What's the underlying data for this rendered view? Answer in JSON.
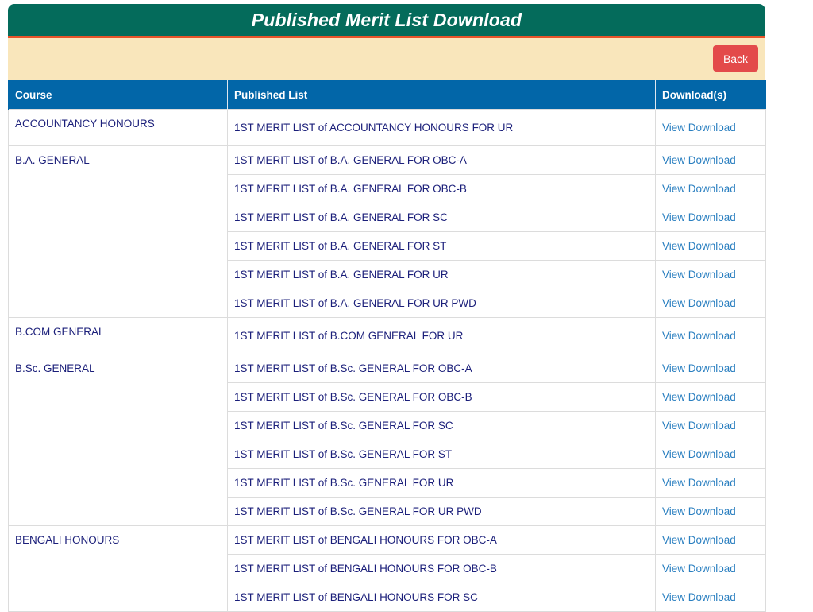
{
  "header": {
    "title": "Published Merit List Download",
    "back_label": "Back"
  },
  "colors": {
    "title_bg": "#046b5b",
    "title_border": "#e8542a",
    "action_bg": "#f9e6bb",
    "back_button": "#e34a4a",
    "table_header": "#0266a8",
    "text": "#1b1f7a",
    "link": "#2a7fc0"
  },
  "table": {
    "columns": [
      "Course",
      "Published List",
      "Download(s)"
    ],
    "download_label": "View Download",
    "groups": [
      {
        "course": "ACCOUNTANCY HONOURS",
        "lists": [
          "1ST MERIT LIST of ACCOUNTANCY HONOURS FOR UR"
        ]
      },
      {
        "course": "B.A. GENERAL",
        "lists": [
          "1ST MERIT LIST of B.A. GENERAL FOR OBC-A",
          "1ST MERIT LIST of B.A. GENERAL FOR OBC-B",
          "1ST MERIT LIST of B.A. GENERAL FOR SC",
          "1ST MERIT LIST of B.A. GENERAL FOR ST",
          "1ST MERIT LIST of B.A. GENERAL FOR UR",
          "1ST MERIT LIST of B.A. GENERAL FOR UR PWD"
        ]
      },
      {
        "course": "B.COM GENERAL",
        "lists": [
          "1ST MERIT LIST of B.COM GENERAL FOR UR"
        ]
      },
      {
        "course": "B.Sc. GENERAL",
        "lists": [
          "1ST MERIT LIST of B.Sc. GENERAL FOR OBC-A",
          "1ST MERIT LIST of B.Sc. GENERAL FOR OBC-B",
          "1ST MERIT LIST of B.Sc. GENERAL FOR SC",
          "1ST MERIT LIST of B.Sc. GENERAL FOR ST",
          "1ST MERIT LIST of B.Sc. GENERAL FOR UR",
          "1ST MERIT LIST of B.Sc. GENERAL FOR UR PWD"
        ]
      },
      {
        "course": "BENGALI HONOURS",
        "lists": [
          "1ST MERIT LIST of BENGALI HONOURS FOR OBC-A",
          "1ST MERIT LIST of BENGALI HONOURS FOR OBC-B",
          "1ST MERIT LIST of BENGALI HONOURS FOR SC"
        ]
      }
    ]
  }
}
